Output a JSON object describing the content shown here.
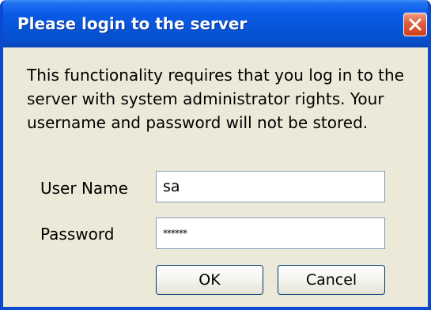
{
  "dialog": {
    "title": "Please login to the server",
    "message_lines": [
      "This functionality requires that you log in to the",
      "server with system administrator rights. Your",
      "username and password will not be stored."
    ],
    "fields": {
      "username": {
        "label": "User Name",
        "value": "sa"
      },
      "password": {
        "label": "Password",
        "value": "******"
      }
    },
    "buttons": {
      "ok": "OK",
      "cancel": "Cancel"
    },
    "close_icon": "close-icon"
  },
  "colors": {
    "titlebar": "#0754d8",
    "frame": "#0a4ad0",
    "body": "#ece9d8",
    "close_button": "#e06040"
  }
}
